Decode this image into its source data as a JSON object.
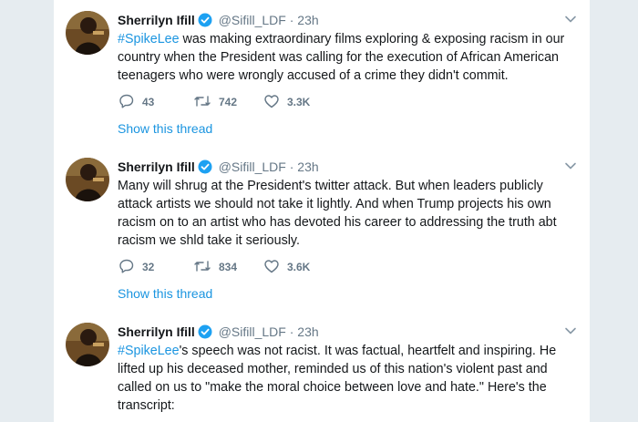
{
  "tweets": [
    {
      "name": "Sherrilyn Ifill",
      "handle": "@Sifill_LDF",
      "dot": "·",
      "time": "23h",
      "hashtag": "#SpikeLee",
      "text": " was making extraordinary films exploring & exposing racism in our country when the President was calling for the execution of African American teenagers who were wrongly accused of a crime they didn't commit.",
      "replies": "43",
      "retweets": "742",
      "likes": "3.3K",
      "thread_label": "Show this thread"
    },
    {
      "name": "Sherrilyn Ifill",
      "handle": "@Sifill_LDF",
      "dot": "·",
      "time": "23h",
      "hashtag": "",
      "text": "Many will shrug at the President's twitter attack. But when leaders publicly attack artists we should not take it lightly. And when Trump projects his own racism on to an artist who has devoted his career to addressing the truth abt racism we shld take it seriously.",
      "replies": "32",
      "retweets": "834",
      "likes": "3.6K",
      "thread_label": "Show this thread"
    },
    {
      "name": "Sherrilyn Ifill",
      "handle": "@Sifill_LDF",
      "dot": "·",
      "time": "23h",
      "hashtag": "#SpikeLee",
      "text": "'s speech was not racist. It was factual, heartfelt and inspiring. He lifted up his deceased mother, reminded us of this nation's violent past and called on us to \"make the moral choice between love and hate.\" Here's the transcript:"
    }
  ],
  "colors": {
    "link": "#1b95e0",
    "muted": "#657786",
    "background": "#e6ecf0"
  },
  "icons": [
    "verified-badge-icon",
    "chevron-down-icon",
    "reply-icon",
    "retweet-icon",
    "like-icon"
  ]
}
